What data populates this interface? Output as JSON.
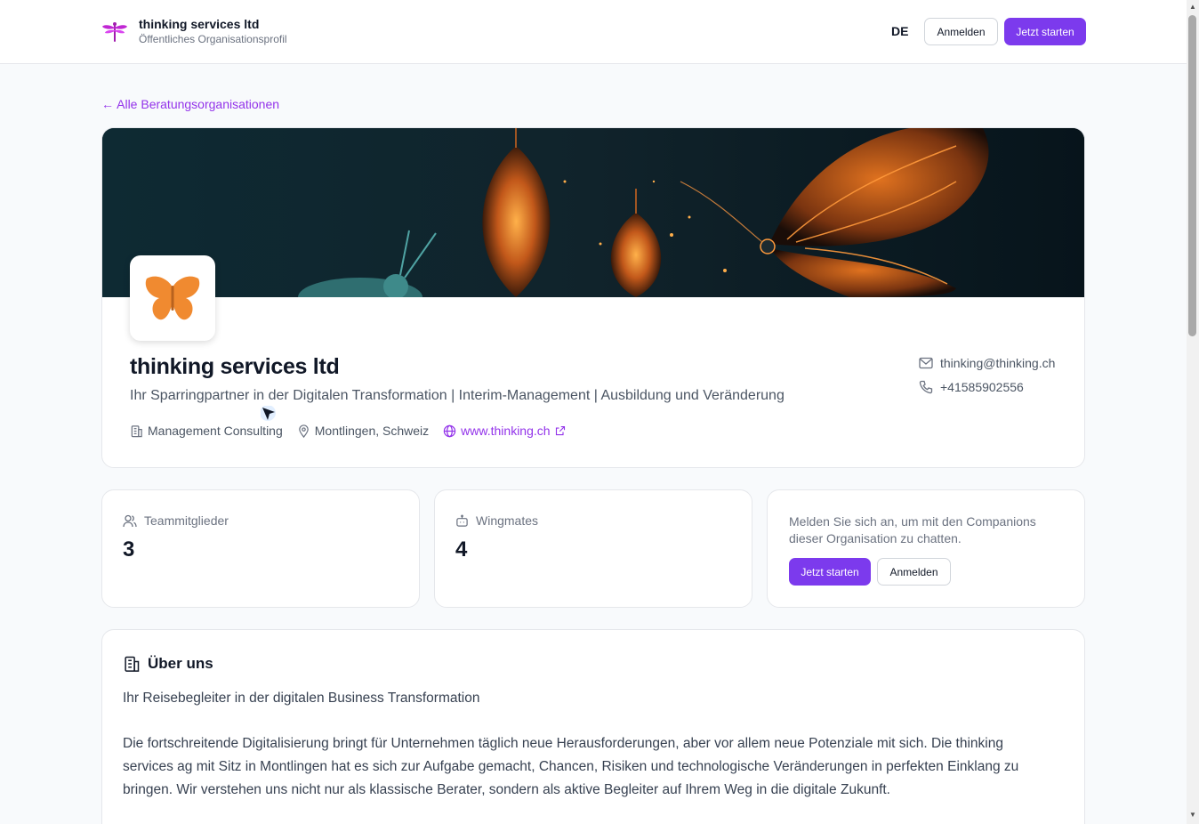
{
  "header": {
    "brand_name": "thinking services ltd",
    "brand_subtitle": "Öffentliches Organisationsprofil",
    "language": "DE",
    "login_label": "Anmelden",
    "start_label": "Jetzt starten"
  },
  "back_link": "← Alle Beratungsorganisationen",
  "profile": {
    "name": "thinking services ltd",
    "tagline": "Ihr Sparringpartner in der Digitalen Transformation | Interim-Management | Ausbildung und Veränderung",
    "industry": "Management Consulting",
    "location": "Montlingen, Schweiz",
    "website": "www.thinking.ch",
    "email": "thinking@thinking.ch",
    "phone": "+41585902556"
  },
  "stats": {
    "team_label": "Teammitglieder",
    "team_value": "3",
    "wingmates_label": "Wingmates",
    "wingmates_value": "4"
  },
  "cta": {
    "text": "Melden Sie sich an, um mit den Companions dieser Organisation zu chatten.",
    "start_label": "Jetzt starten",
    "login_label": "Anmelden"
  },
  "about": {
    "title": "Über uns",
    "lead": "Ihr Reisebegleiter in der digitalen Business Transformation",
    "body": "Die fortschreitende Digitalisierung bringt für Unternehmen täglich neue Herausforderungen, aber vor allem neue Potenziale mit sich. Die thinking services ag mit Sitz in Montlingen hat es sich zur Aufgabe gemacht, Chancen, Risiken und technologische Veränderungen in perfekten Einklang zu bringen. Wir verstehen uns nicht nur als klassische Berater, sondern als aktive Begleiter auf Ihrem Weg in die digitale Zukunft."
  },
  "colors": {
    "accent": "#7c3aed",
    "link": "#9333ea",
    "butterfly": "#f08a30"
  },
  "icons": [
    "dragonfly-logo-icon",
    "building-icon",
    "map-pin-icon",
    "globe-icon",
    "external-link-icon",
    "mail-icon",
    "phone-icon",
    "users-icon",
    "bot-icon",
    "butterfly-icon"
  ]
}
